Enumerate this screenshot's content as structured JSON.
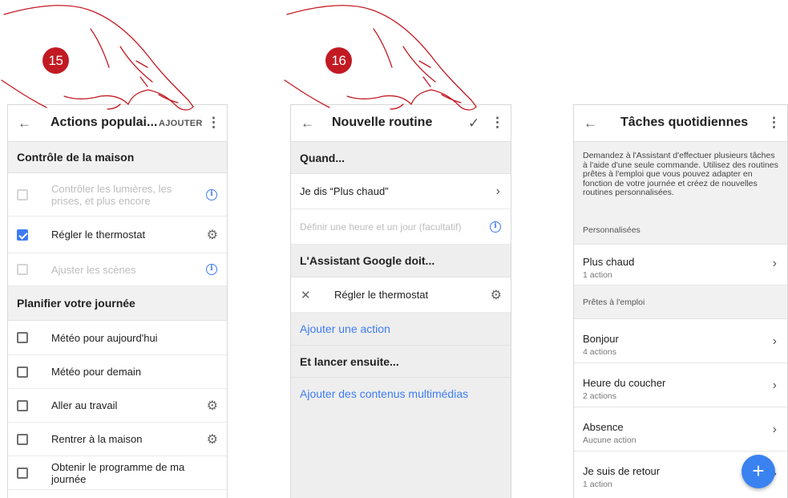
{
  "steps": {
    "first": "15",
    "second": "16"
  },
  "screen1": {
    "title": "Actions populai...",
    "add_button": "AJOUTER",
    "sections": [
      {
        "title": "Contrôle de la maison"
      },
      {
        "title": "Planifier votre journée"
      }
    ],
    "home_items": [
      {
        "label": "Contrôler les lumières, les prises, et plus encore",
        "checked": false,
        "disabled": true,
        "trailing_icon": "info-icon"
      },
      {
        "label": "Régler le thermostat",
        "checked": true,
        "disabled": false,
        "trailing_icon": "gear-icon"
      },
      {
        "label": "Ajuster les scènes",
        "checked": false,
        "disabled": true,
        "trailing_icon": "info-icon"
      }
    ],
    "day_items": [
      {
        "label": "Météo pour aujourd'hui",
        "checked": false,
        "trailing_icon": ""
      },
      {
        "label": "Météo pour demain",
        "checked": false,
        "trailing_icon": ""
      },
      {
        "label": "Aller au travail",
        "checked": false,
        "trailing_icon": "gear-icon"
      },
      {
        "label": "Rentrer à la maison",
        "checked": false,
        "trailing_icon": "gear-icon"
      },
      {
        "label": "Obtenir le programme de ma journée",
        "checked": false,
        "trailing_icon": ""
      }
    ]
  },
  "screen2": {
    "title": "Nouvelle routine",
    "when_header": "Quand...",
    "trigger": "Je dis “Plus chaud”",
    "time_placeholder": "Définir une heure et un jour (facultatif)",
    "assistant_header": "L'Assistant Google doit...",
    "action_item": "Régler le thermostat",
    "add_action": "Ajouter une action",
    "then_header": "Et lancer ensuite...",
    "add_media": "Ajouter des contenus multimédias"
  },
  "screen3": {
    "title": "Tâches quotidiennes",
    "description": "Demandez à l'Assistant d'effectuer plusieurs tâches à l'aide d'une seule commande. Utilisez des routines prêtes à l'emploi que vous pouvez adapter en fonction de votre journée et créez de nouvelles routines personnalisées.",
    "custom_header": "Personnalisées",
    "custom_routines": [
      {
        "name": "Plus chaud",
        "sub": "1 action"
      }
    ],
    "ready_header": "Prêtes à l'emploi",
    "ready_routines": [
      {
        "name": "Bonjour",
        "sub": "4 actions"
      },
      {
        "name": "Heure du coucher",
        "sub": "2 actions"
      },
      {
        "name": "Absence",
        "sub": "Aucune action"
      },
      {
        "name": "Je suis de retour",
        "sub": "1 action"
      }
    ]
  },
  "icons": {
    "back": "arrow-left-icon",
    "more": "more-vert-icon",
    "confirm": "check-icon",
    "remove": "close-icon",
    "chevron": "chevron-right-icon",
    "fab": "plus-icon"
  },
  "colors": {
    "accent": "#3d7cf2",
    "step_badge": "#c21a23",
    "hand_outline": "#c21a23"
  }
}
